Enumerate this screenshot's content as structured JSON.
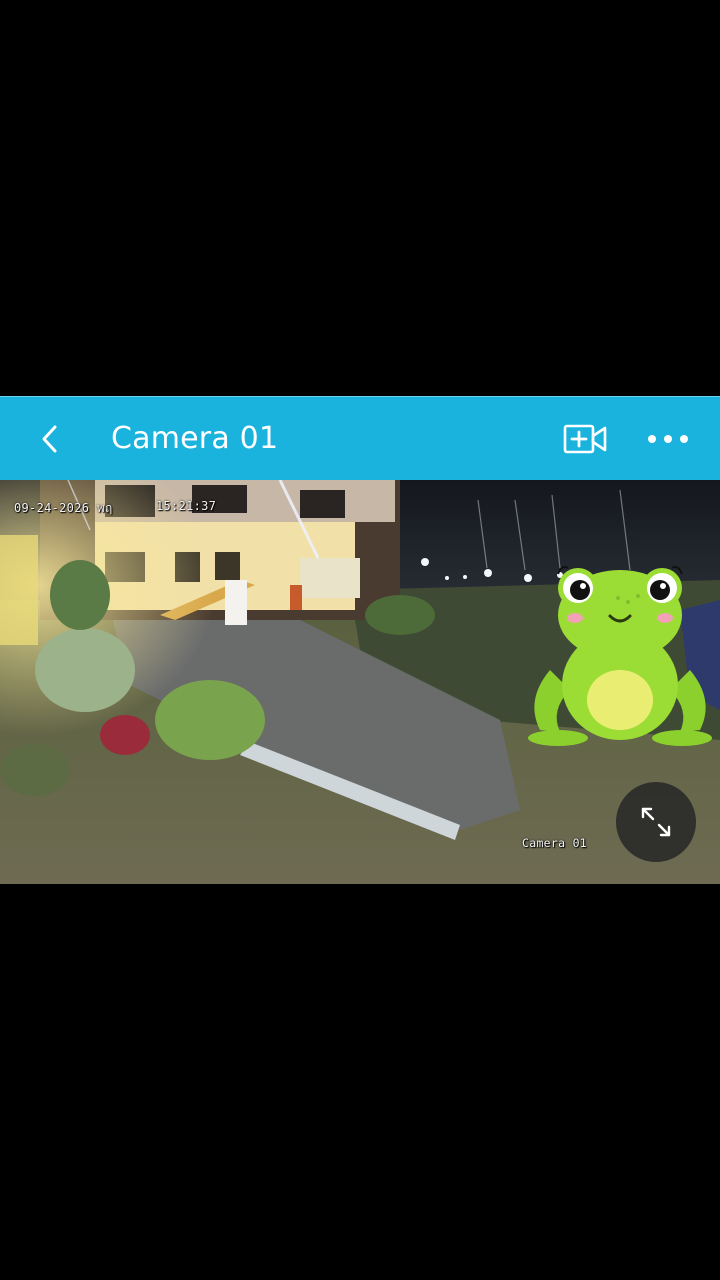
{
  "header": {
    "title": "Camera 01",
    "background_color": "#19b3dd",
    "back_icon": "chevron-left-icon",
    "add_icon": "video-add-icon",
    "more_icon": "more-horizontal-icon"
  },
  "video": {
    "osd_date": "09-24-2026 พฤ",
    "osd_time": "15:21:37",
    "osd_camera_name": "Camera 01",
    "fullscreen_icon": "expand-icon",
    "sticker": "frog-sticker"
  }
}
